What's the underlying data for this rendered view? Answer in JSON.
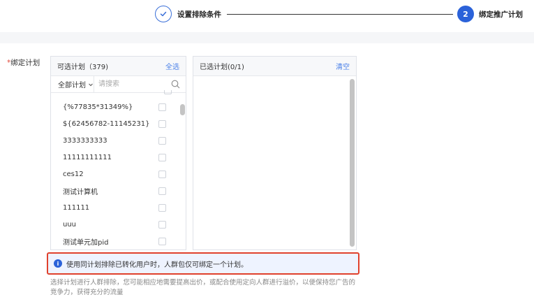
{
  "stepper": {
    "step1_label": "设置排除条件",
    "step2_number": "2",
    "step2_label": "绑定推广计划",
    "check_icon": "check-icon"
  },
  "form": {
    "required_mark": "*",
    "field_label": "绑定计划"
  },
  "available_panel": {
    "title": "可选计划（379)",
    "select_all": "全选",
    "filter_select": "全部计划",
    "search_placeholder": "请搜索",
    "items": [
      {
        "label": "{%77835*31349%}"
      },
      {
        "label": "${62456782-11145231}"
      },
      {
        "label": "3333333333"
      },
      {
        "label": "11111111111"
      },
      {
        "label": "ces12"
      },
      {
        "label": "测试计算机"
      },
      {
        "label": "111111"
      },
      {
        "label": "uuu"
      },
      {
        "label": "测试单元加pid"
      }
    ]
  },
  "selected_panel": {
    "title": "已选计划(0/1)",
    "clear": "清空"
  },
  "notice": {
    "text": "使用同计划排除已转化用户时，人群包仅可绑定一个计划。"
  },
  "help": {
    "text": "选择计划进行人群排除，您可能相应地需要提高出价，或配合使用定向人群进行溢价，以便保持您广告的竞争力，获得充分的流量"
  },
  "colors": {
    "accent": "#2b62d9",
    "link": "#4a80e8",
    "highlight_border": "#e0412d"
  }
}
